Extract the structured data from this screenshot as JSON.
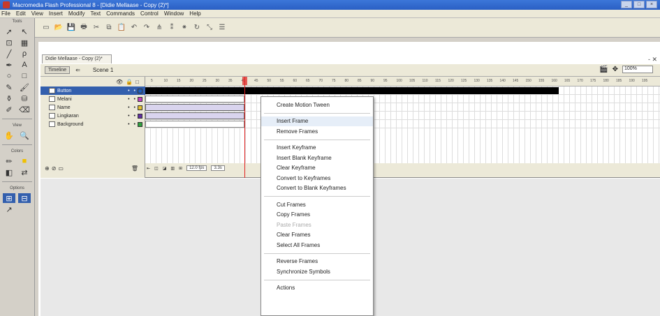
{
  "window": {
    "title": "Macromedia Flash Professional 8 - [Didie Mellaase - Copy (2)*]",
    "controls": [
      "_",
      "□",
      "×"
    ]
  },
  "menu": [
    "File",
    "Edit",
    "View",
    "Insert",
    "Modify",
    "Text",
    "Commands",
    "Control",
    "Window",
    "Help"
  ],
  "tools": {
    "label": "Tools",
    "view_label": "View",
    "colors_label": "Colors",
    "options_label": "Options"
  },
  "document": {
    "tab": "Didie Mellaase - Copy (2)*",
    "close": "- ✕"
  },
  "scene_bar": {
    "timeline_button": "Timeline",
    "scene": "Scene 1",
    "zoom": "100%"
  },
  "layers": [
    {
      "name": "Button",
      "selected": true,
      "color": "#1f5fbf"
    },
    {
      "name": "Melani",
      "selected": false,
      "color": "#c040c0"
    },
    {
      "name": "Name",
      "selected": false,
      "color": "#e0c030"
    },
    {
      "name": "Lingkaran",
      "selected": false,
      "color": "#6030a0"
    },
    {
      "name": "Background",
      "selected": false,
      "color": "#30a040"
    }
  ],
  "ruler": [
    "5",
    "10",
    "15",
    "20",
    "25",
    "30",
    "35",
    "40",
    "45",
    "50",
    "55",
    "60",
    "65",
    "70",
    "75",
    "80",
    "85",
    "90",
    "95",
    "100",
    "105",
    "110",
    "115",
    "120",
    "125",
    "130",
    "135",
    "140",
    "145",
    "150",
    "155",
    "160",
    "165",
    "170",
    "175",
    "180",
    "185",
    "190",
    "195"
  ],
  "timeline_status": {
    "fps": "12.0 fps",
    "time": "3.3s"
  },
  "context_menu": [
    {
      "label": "Create Motion Tween",
      "state": "normal"
    },
    {
      "sep": true
    },
    {
      "label": "Insert Frame",
      "state": "hover"
    },
    {
      "label": "Remove Frames",
      "state": "normal"
    },
    {
      "sep": true
    },
    {
      "label": "Insert Keyframe",
      "state": "normal"
    },
    {
      "label": "Insert Blank Keyframe",
      "state": "normal"
    },
    {
      "label": "Clear Keyframe",
      "state": "normal"
    },
    {
      "label": "Convert to Keyframes",
      "state": "normal"
    },
    {
      "label": "Convert to Blank Keyframes",
      "state": "normal"
    },
    {
      "sep": true
    },
    {
      "label": "Cut Frames",
      "state": "normal"
    },
    {
      "label": "Copy Frames",
      "state": "normal"
    },
    {
      "label": "Paste Frames",
      "state": "disabled"
    },
    {
      "label": "Clear Frames",
      "state": "normal"
    },
    {
      "label": "Select All Frames",
      "state": "normal"
    },
    {
      "sep": true
    },
    {
      "label": "Reverse Frames",
      "state": "normal"
    },
    {
      "label": "Synchronize Symbols",
      "state": "normal"
    },
    {
      "sep": true
    },
    {
      "label": "Actions",
      "state": "normal"
    }
  ]
}
